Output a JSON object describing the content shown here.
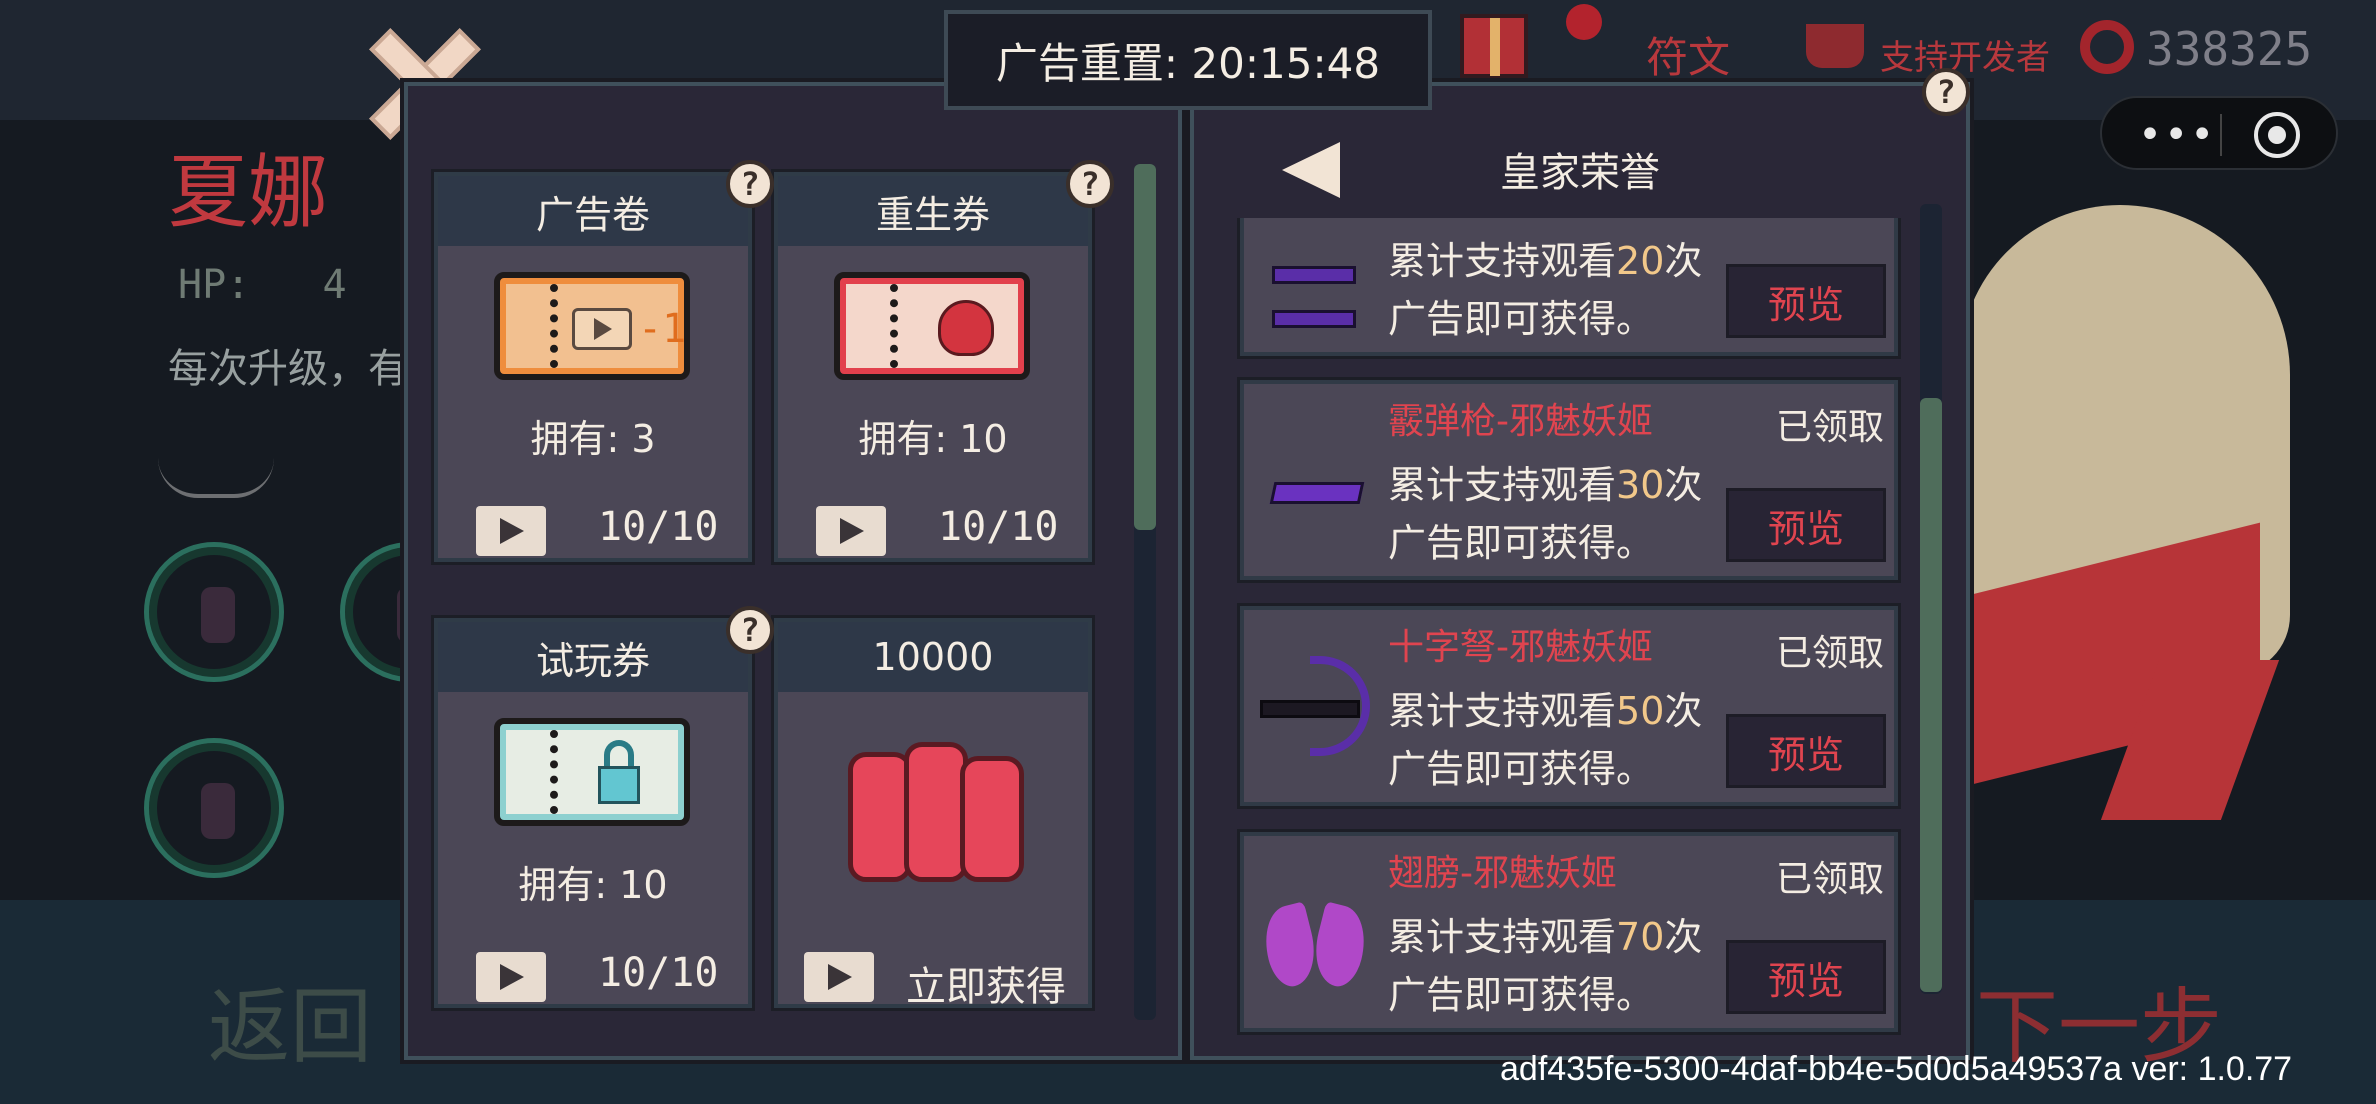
{
  "background": {
    "character_name": "夏娜",
    "hp_label": "HP:",
    "hp_value": "4",
    "description": "每次升级，有",
    "back_label": "返回",
    "next_label": "下一步"
  },
  "topbar": {
    "rune_label": "符文",
    "support_label": "支持开发者",
    "coin_count": "338325"
  },
  "timer": {
    "label": "广告重置: 20:15:48"
  },
  "left_panel": {
    "cards": [
      {
        "title": "广告卷",
        "owned": "拥有:  3",
        "count": "10/10",
        "icon": "ad-ticket-icon"
      },
      {
        "title": "重生券",
        "owned": "拥有:  10",
        "count": "10/10",
        "icon": "heart-ticket-icon"
      },
      {
        "title": "试玩券",
        "owned": "拥有:  10",
        "count": "10/10",
        "icon": "lock-ticket-icon"
      },
      {
        "title": "10000",
        "count": "立即获得",
        "icon": "coins-stack-icon"
      }
    ],
    "ad_ticket_badge": "-1"
  },
  "right_panel": {
    "title": "皇家荣誉",
    "rewards": [
      {
        "name": "",
        "line1_prefix": "累计支持观看",
        "line1_num": "20",
        "line1_suffix": "次",
        "line2": "广告即可获得。",
        "status": "",
        "button": "预览",
        "icon": "pistol-icon"
      },
      {
        "name": "霰弹枪-邪魅妖姬",
        "line1_prefix": "累计支持观看",
        "line1_num": "30",
        "line1_suffix": "次",
        "line2": "广告即可获得。",
        "status": "已领取",
        "button": "预览",
        "icon": "shotgun-icon"
      },
      {
        "name": "十字弩-邪魅妖姬",
        "line1_prefix": "累计支持观看",
        "line1_num": "50",
        "line1_suffix": "次",
        "line2": "广告即可获得。",
        "status": "已领取",
        "button": "预览",
        "icon": "crossbow-icon"
      },
      {
        "name": "翅膀-邪魅妖姬",
        "line1_prefix": "累计支持观看",
        "line1_num": "70",
        "line1_suffix": "次",
        "line2": "广告即可获得。",
        "status": "已领取",
        "button": "预览",
        "icon": "wings-icon"
      }
    ]
  },
  "help_glyph": "?",
  "version": "adf435fe-5300-4daf-bb4e-5d0d5a49537a ver: 1.0.77",
  "colors": {
    "accent_red": "#e0444f",
    "panel_bg": "#2a2737",
    "card_bg": "#4b4756",
    "highlight": "#f2c88a"
  }
}
